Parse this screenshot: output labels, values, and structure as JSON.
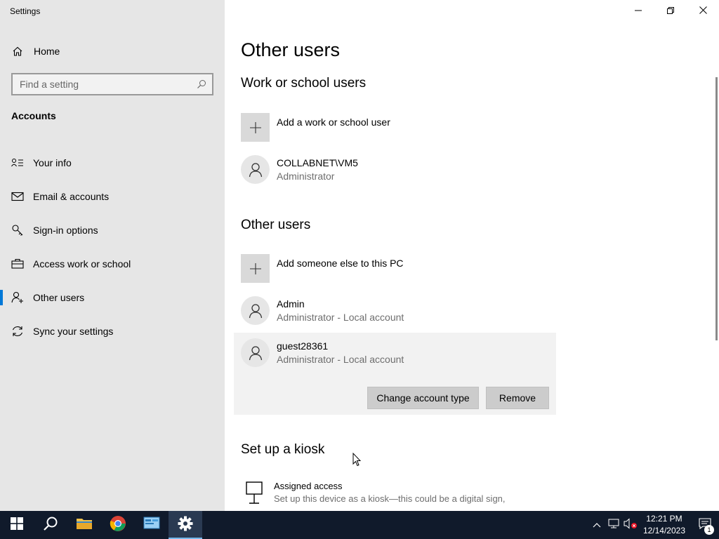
{
  "window": {
    "title": "Settings"
  },
  "sidebar": {
    "home_label": "Home",
    "search_placeholder": "Find a setting",
    "section_title": "Accounts",
    "items": [
      {
        "label": "Your info",
        "icon": "contact-card-icon"
      },
      {
        "label": "Email & accounts",
        "icon": "mail-icon"
      },
      {
        "label": "Sign-in options",
        "icon": "key-icon"
      },
      {
        "label": "Access work or school",
        "icon": "briefcase-icon"
      },
      {
        "label": "Other users",
        "icon": "add-person-icon",
        "active": true
      },
      {
        "label": "Sync your settings",
        "icon": "sync-icon"
      }
    ]
  },
  "main": {
    "page_title": "Other users",
    "work_section": {
      "heading": "Work or school users",
      "add_label": "Add a work or school user",
      "users": [
        {
          "name": "COLLABNET\\VM5",
          "role": "Administrator"
        }
      ]
    },
    "other_section": {
      "heading": "Other users",
      "add_label": "Add someone else to this PC",
      "users": [
        {
          "name": "Admin",
          "role": "Administrator - Local account"
        },
        {
          "name": "guest28361",
          "role": "Administrator - Local account",
          "selected": true
        }
      ],
      "change_account_type_label": "Change account type",
      "remove_label": "Remove"
    },
    "kiosk_section": {
      "heading": "Set up a kiosk",
      "item_title": "Assigned access",
      "item_desc": "Set up this device as a kiosk—this could be a digital sign,"
    }
  },
  "taskbar": {
    "apps": [
      "start",
      "search",
      "file-explorer",
      "chrome",
      "control-panel",
      "settings"
    ],
    "clock_time": "12:21 PM",
    "clock_date": "12/14/2023",
    "notification_count": "1"
  },
  "colors": {
    "accent": "#0078d7",
    "sidebar_bg": "#e6e6e6",
    "taskbar_bg": "#101a2b"
  }
}
